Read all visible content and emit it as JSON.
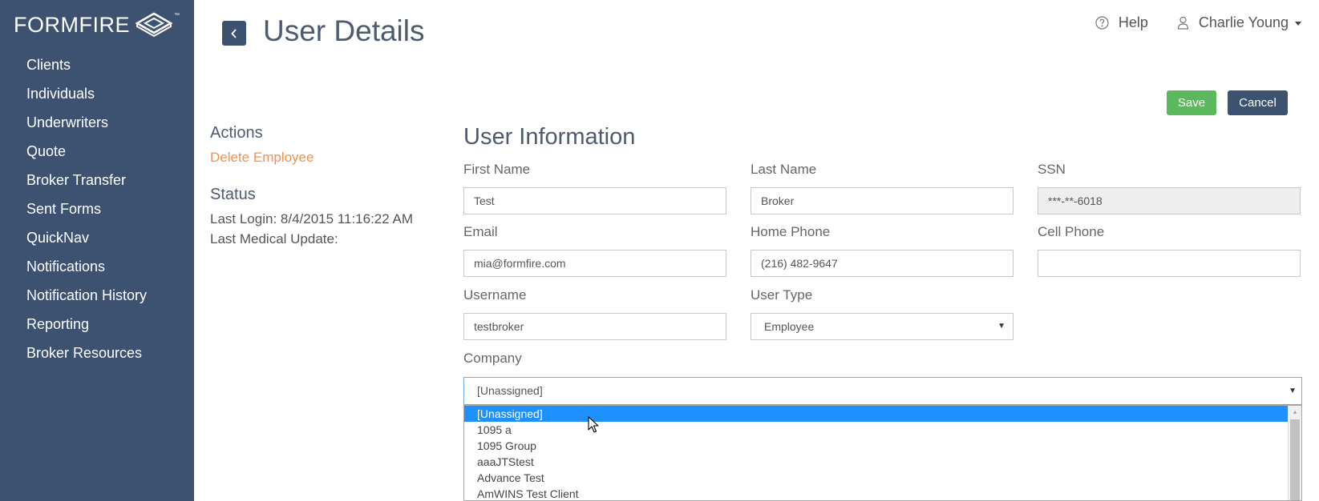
{
  "brand": {
    "name": "FORMFIRE",
    "tm": "™"
  },
  "sidebar": {
    "items": [
      {
        "label": "Clients"
      },
      {
        "label": "Individuals"
      },
      {
        "label": "Underwriters"
      },
      {
        "label": "Quote"
      },
      {
        "label": "Broker Transfer"
      },
      {
        "label": "Sent Forms"
      },
      {
        "label": "QuickNav"
      },
      {
        "label": "Notifications"
      },
      {
        "label": "Notification History"
      },
      {
        "label": "Reporting"
      },
      {
        "label": "Broker Resources"
      }
    ]
  },
  "header": {
    "title": "User Details",
    "help_label": "Help",
    "user_name": "Charlie Young"
  },
  "buttons": {
    "save": "Save",
    "cancel": "Cancel"
  },
  "left_panel": {
    "actions_heading": "Actions",
    "delete_link": "Delete Employee",
    "status_heading": "Status",
    "last_login": "Last Login: 8/4/2015 11:16:22 AM",
    "last_medical": "Last Medical Update:"
  },
  "form": {
    "title": "User Information",
    "first_name": {
      "label": "First Name",
      "value": "Test"
    },
    "last_name": {
      "label": "Last Name",
      "value": "Broker"
    },
    "ssn": {
      "label": "SSN",
      "value": "***-**-6018"
    },
    "email": {
      "label": "Email",
      "value": "mia@formfire.com"
    },
    "home_phone": {
      "label": "Home Phone",
      "value": "(216) 482-9647"
    },
    "cell_phone": {
      "label": "Cell Phone",
      "value": ""
    },
    "username": {
      "label": "Username",
      "value": "testbroker"
    },
    "user_type": {
      "label": "User Type",
      "value": "Employee"
    },
    "company": {
      "label": "Company",
      "value": "[Unassigned]",
      "options": [
        "[Unassigned]",
        "1095 a",
        "1095 Group",
        "aaaJTStest",
        "Advance Test",
        "AmWINS Test Client"
      ]
    }
  },
  "colors": {
    "sidebar_bg": "#3d5170",
    "save_green": "#5cb85c",
    "link_orange": "#f0924e",
    "selected_blue": "#1e90ff"
  }
}
